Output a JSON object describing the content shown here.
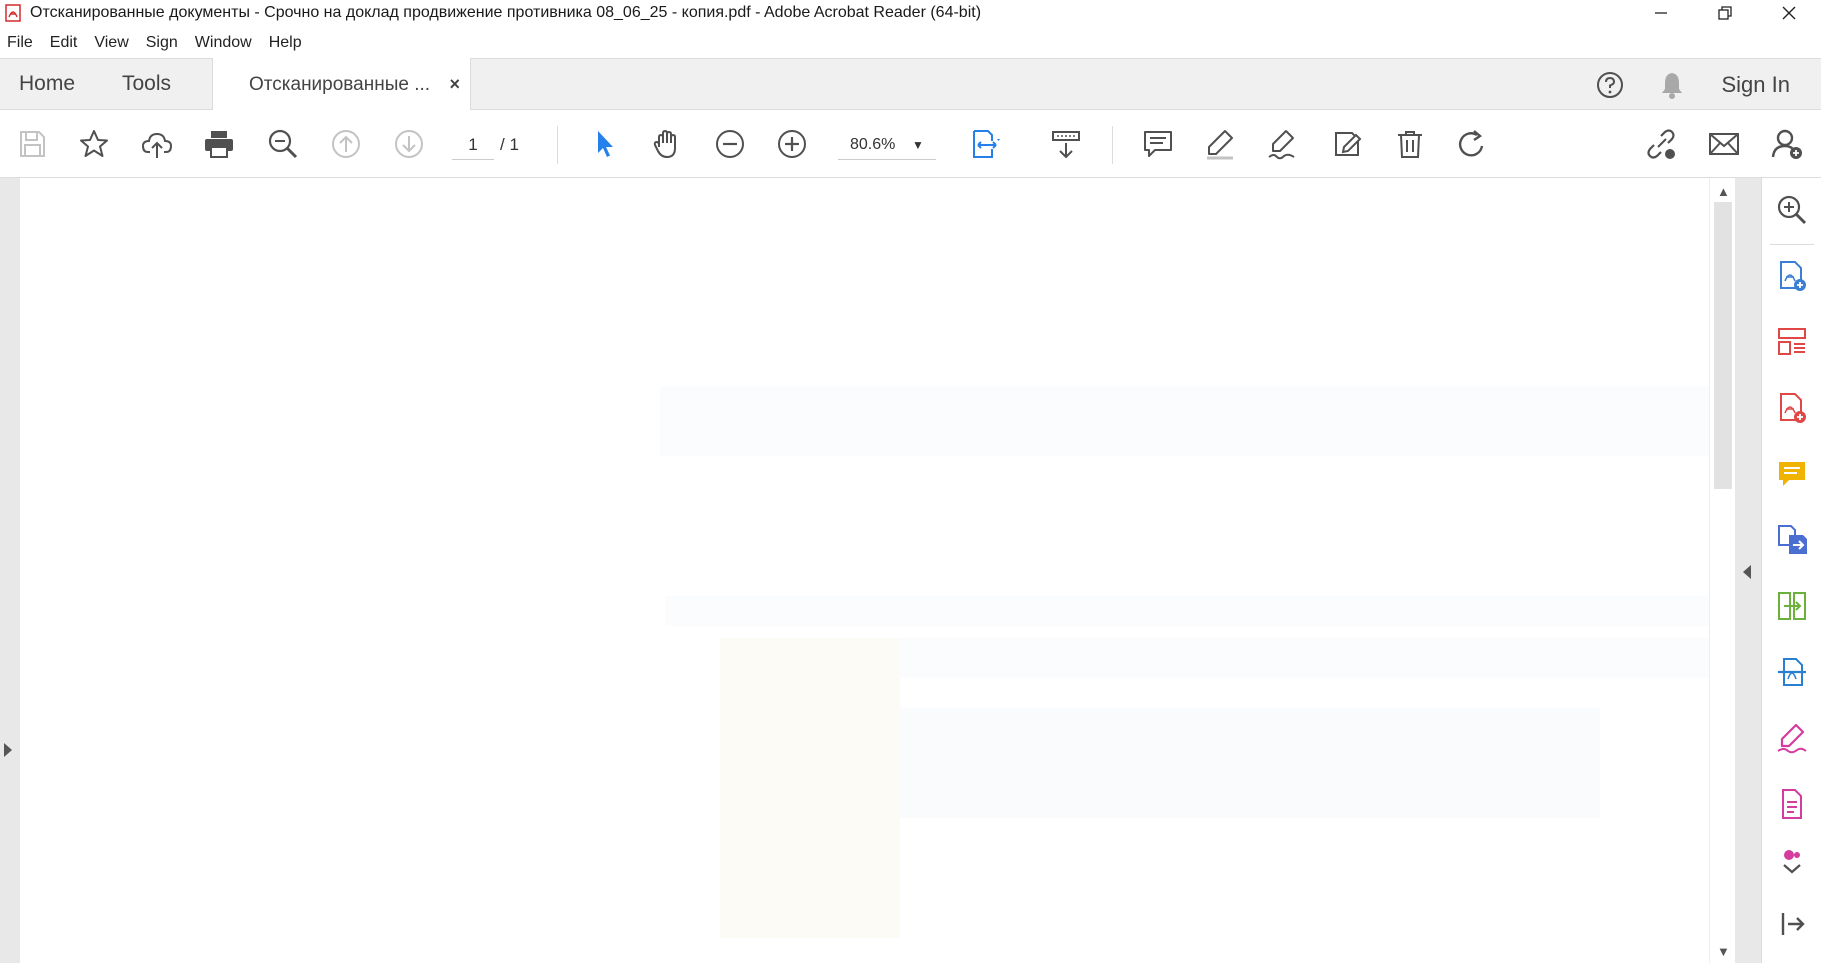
{
  "window": {
    "title": "Отсканированные документы - Срочно на доклад продвижение противника 08_06_25 - копия.pdf - Adobe Acrobat Reader (64-bit)",
    "minimize_icon": "minimize-icon",
    "maximize_icon": "restore-icon",
    "close_icon": "close-icon"
  },
  "menu": [
    "File",
    "Edit",
    "View",
    "Sign",
    "Window",
    "Help"
  ],
  "tabs": {
    "home": "Home",
    "tools": "Tools",
    "document": "Отсканированные ...",
    "close": "×"
  },
  "header_right": {
    "help_icon": "help-icon",
    "notifications_icon": "bell-icon",
    "sign_in": "Sign In"
  },
  "toolbar": {
    "page_current": "1",
    "page_total": "/ 1",
    "zoom": "80.6%",
    "icons": [
      "save-icon",
      "bookmark-star-icon",
      "upload-cloud-icon",
      "print-icon",
      "zoom-search-icon",
      "page-up-icon",
      "page-down-icon",
      "select-arrow-icon",
      "hand-icon",
      "zoom-out-icon",
      "zoom-in-icon",
      "fit-page-icon",
      "scroll-mode-icon",
      "comment-icon",
      "highlight-icon",
      "sign-icon",
      "stamp-icon",
      "delete-icon",
      "rotate-icon",
      "share-link-icon",
      "email-icon",
      "add-user-icon"
    ]
  },
  "right_panel_icons": [
    "search-zoom-icon",
    "create-pdf-icon",
    "organize-pages-icon",
    "edit-pdf-icon",
    "comment-tool-icon",
    "export-pdf-icon",
    "combine-files-icon",
    "scan-ocr-icon",
    "fill-sign-icon",
    "more-tools-icon",
    "expand-more-icon",
    "collapse-panel-icon"
  ],
  "colors": {
    "accent_blue": "#2680eb",
    "icon_gray": "#505050",
    "tab_bar_bg": "#f0f0f0",
    "create_pdf": "#3b7fd4",
    "organize": "#e04848",
    "edit": "#e04848",
    "comment": "#f0b400",
    "export": "#4a6fd1",
    "combine": "#6bb13c",
    "scan": "#2a7fd0",
    "sign": "#d43c9e",
    "more": "#d43c9e"
  }
}
